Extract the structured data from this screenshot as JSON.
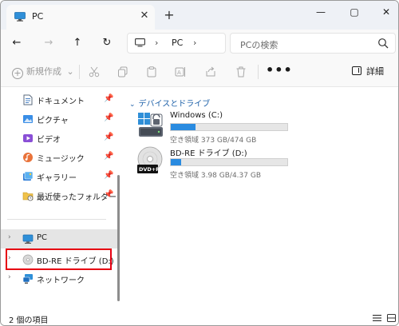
{
  "tab": {
    "title": "PC",
    "close_glyph": "✕",
    "new_glyph": "+",
    "icon": "computer-icon"
  },
  "window_controls": {
    "minimize": "—",
    "maximize": "▢",
    "close": "✕"
  },
  "nav": {
    "back": "←",
    "forward": "→",
    "up": "↑",
    "refresh": "↻"
  },
  "address": {
    "chevron": "›",
    "path": "PC"
  },
  "search": {
    "placeholder": "PCの検索"
  },
  "commands": {
    "new_label": "新規作成",
    "new_dropdown": "⌄",
    "more": "•••",
    "details_label": "詳細"
  },
  "sidebar": {
    "quick_access": [
      {
        "label": "ドキュメント",
        "icon": "documents-icon"
      },
      {
        "label": "ピクチャ",
        "icon": "pictures-icon"
      },
      {
        "label": "ビデオ",
        "icon": "videos-icon"
      },
      {
        "label": "ミュージック",
        "icon": "music-icon"
      },
      {
        "label": "ギャラリー",
        "icon": "gallery-icon"
      },
      {
        "label": "最近使ったフォルダー",
        "icon": "recent-folder-icon"
      }
    ],
    "pin_glyph": "📌",
    "tree": [
      {
        "label": "PC",
        "icon": "computer-icon",
        "selected": true
      },
      {
        "label": "BD-RE ドライブ (D:)",
        "icon": "disc-icon",
        "selected": false
      },
      {
        "label": "ネットワーク",
        "icon": "network-icon",
        "selected": false
      }
    ],
    "chevron": "›"
  },
  "main": {
    "group_header": "デバイスとドライブ",
    "group_chevron": "⌄",
    "drives": [
      {
        "name": "Windows (C:)",
        "info": "空き領域 373 GB/474 GB",
        "used_fraction": 0.21,
        "icon": "windows-drive-icon"
      },
      {
        "name": "BD-RE ドライブ (D:)",
        "info": "空き領域 3.98 GB/4.37 GB",
        "used_fraction": 0.09,
        "icon": "dvd-drive-icon",
        "badge": "DVD+R"
      }
    ]
  },
  "status": {
    "item_count": "2 個の項目"
  },
  "colors": {
    "accent": "#2a8be0",
    "highlight": "#e60012",
    "link": "#1b5fa8"
  }
}
